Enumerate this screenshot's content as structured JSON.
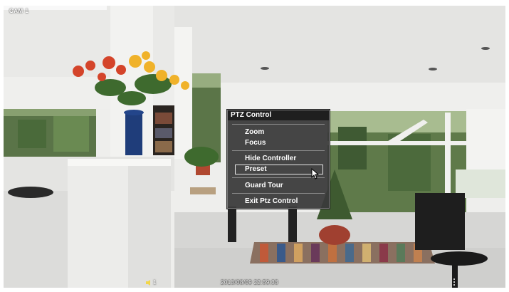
{
  "camera": {
    "label": "CAM 1"
  },
  "ptz_menu": {
    "title": "PTZ Control",
    "group1": [
      {
        "label": "Zoom"
      },
      {
        "label": "Focus"
      }
    ],
    "group2": [
      {
        "label": "Hide Controller"
      },
      {
        "label": "Preset",
        "selected": true
      }
    ],
    "group3": [
      {
        "label": "Guard Tour"
      }
    ],
    "group4": [
      {
        "label": "Exit Ptz Control"
      }
    ]
  },
  "status_bar": {
    "icon": "speaker-icon",
    "channel_count": "1",
    "timestamp": "2013/08/09 22:59:33"
  },
  "colors": {
    "menu_bg": "#3a3a3a",
    "menu_title_bg": "#1f1f1f",
    "menu_text": "#ffffff"
  }
}
